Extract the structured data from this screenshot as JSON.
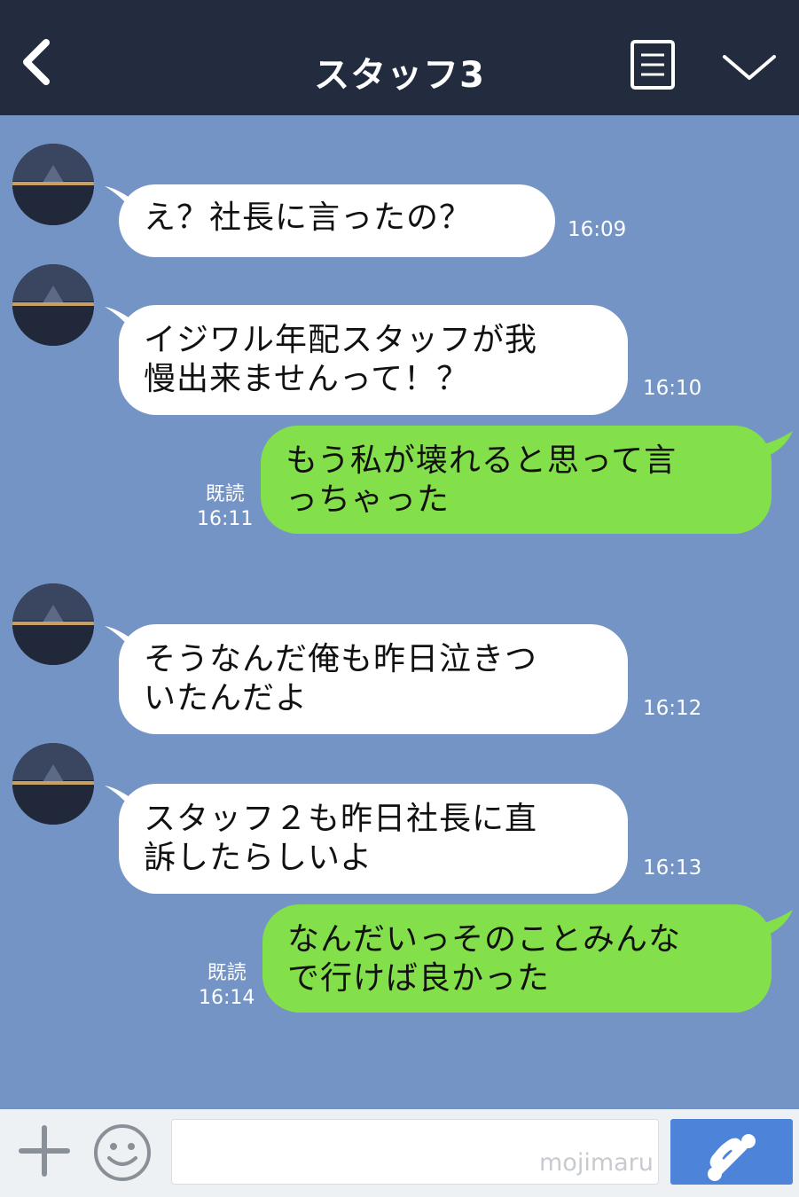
{
  "header": {
    "title": "スタッフ3",
    "back_icon": "chevron-left-icon",
    "menu_icon": "list-icon",
    "collapse_icon": "chevron-down-icon",
    "background": "#232b3e"
  },
  "chat": {
    "background": "#7394c4",
    "incoming_bubble_color": "#ffffff",
    "outgoing_bubble_color": "#84e04a",
    "messages": [
      {
        "direction": "incoming",
        "text": "え？社長に言ったの？",
        "time": "16:09"
      },
      {
        "direction": "incoming",
        "text": "イジワル年配スタッフが我\n慢出来ませんって！？",
        "time": "16:10"
      },
      {
        "direction": "outgoing",
        "text": "もう私が壊れると思って言\nっちゃった",
        "read_label": "既読",
        "time": "16:11"
      },
      {
        "direction": "incoming",
        "text": "そうなんだ俺も昨日泣きつ\nいたんだよ",
        "time": "16:12"
      },
      {
        "direction": "incoming",
        "text": "スタッフ２も昨日社長に直\n訴したらしいよ",
        "time": "16:13"
      },
      {
        "direction": "outgoing",
        "text": "なんだいっそのことみんな\nで行けば良かった",
        "read_label": "既読",
        "time": "16:14"
      }
    ]
  },
  "input_bar": {
    "plus_icon": "plus-icon",
    "emoji_icon": "smiley-icon",
    "input_value": "",
    "watermark": "mojimaru",
    "call_icon": "phone-icon",
    "call_button_color": "#4d83d8"
  }
}
